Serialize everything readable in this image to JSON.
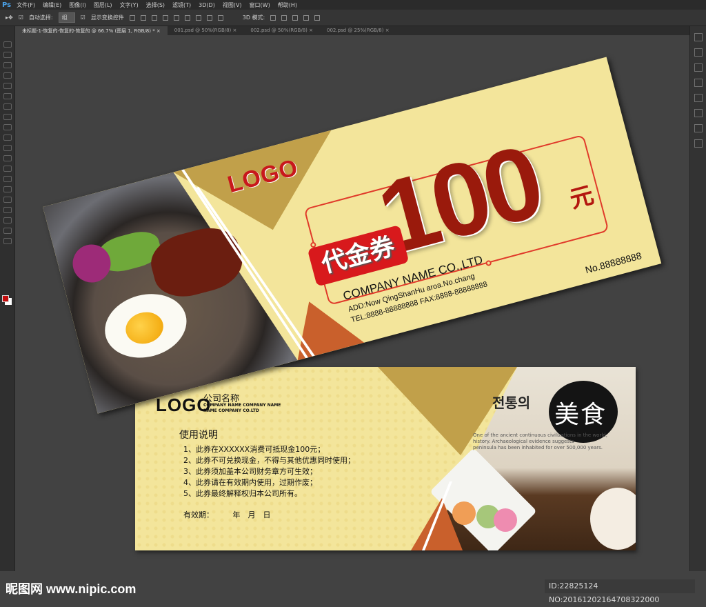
{
  "app": {
    "logo": "Ps",
    "menus": [
      "文件(F)",
      "编辑(E)",
      "图像(I)",
      "图层(L)",
      "文字(Y)",
      "选择(S)",
      "滤镜(T)",
      "3D(D)",
      "视图(V)",
      "窗口(W)",
      "帮助(H)"
    ]
  },
  "options": {
    "auto_select_label": "自动选择:",
    "auto_select_value": "组",
    "show_transform_label": "显示变换控件",
    "mode_3d_label": "3D 模式:"
  },
  "tabs": [
    "未标题-1-恢复的-恢复的-恢复的 @ 66.7% (图层 1, RGB/8) *",
    "001.psd @ 50%(RGB/8)",
    "002.psd @ 50%(RGB/8)",
    "002.psd @ 25%(RGB/8)"
  ],
  "colors": {
    "foreground": "#c40d0d",
    "background": "#ffffff"
  },
  "voucher_front": {
    "logo": "LOGO",
    "amount": "100",
    "unit": "元",
    "badge": "代金券",
    "company": "COMPANY NAME CO.,LTD",
    "address": "ADD:Now QingShanHu aroa.No.chang",
    "tel": "TEL:8888-88888888  FAX:8888-88888888",
    "number": "No.88888888"
  },
  "voucher_back": {
    "logo": "LOGO",
    "company_cn": "公司名称",
    "company_en_1": "COMPANY NAME COMPANY NAME",
    "company_en_2": "NAME COMPANY CO.LTD",
    "title": "使用说明",
    "rules": [
      "1、此券在XXXXXX消费可抵现金100元；",
      "2、此券不可兑换现金，不得与其他优惠同时使用；",
      "3、此券须加盖本公司财务章方可生效；",
      "4、此券请在有效期内使用，过期作废；",
      "5、此券最终解释权归本公司所有。"
    ],
    "validity": "有效期：　　　年　月　日",
    "image_text": {
      "korean": "전통의",
      "calligraphy": "美食",
      "lines": [
        "One of the ancient continuous civilizations in the world,",
        "history. Archaeological evidence suggests",
        "peninsula has been inhabited for over 500,000 years."
      ]
    }
  },
  "watermark": {
    "site": "昵图网 www.nipic.com",
    "id": "ID:22825124 NO:20161202164708322000"
  }
}
